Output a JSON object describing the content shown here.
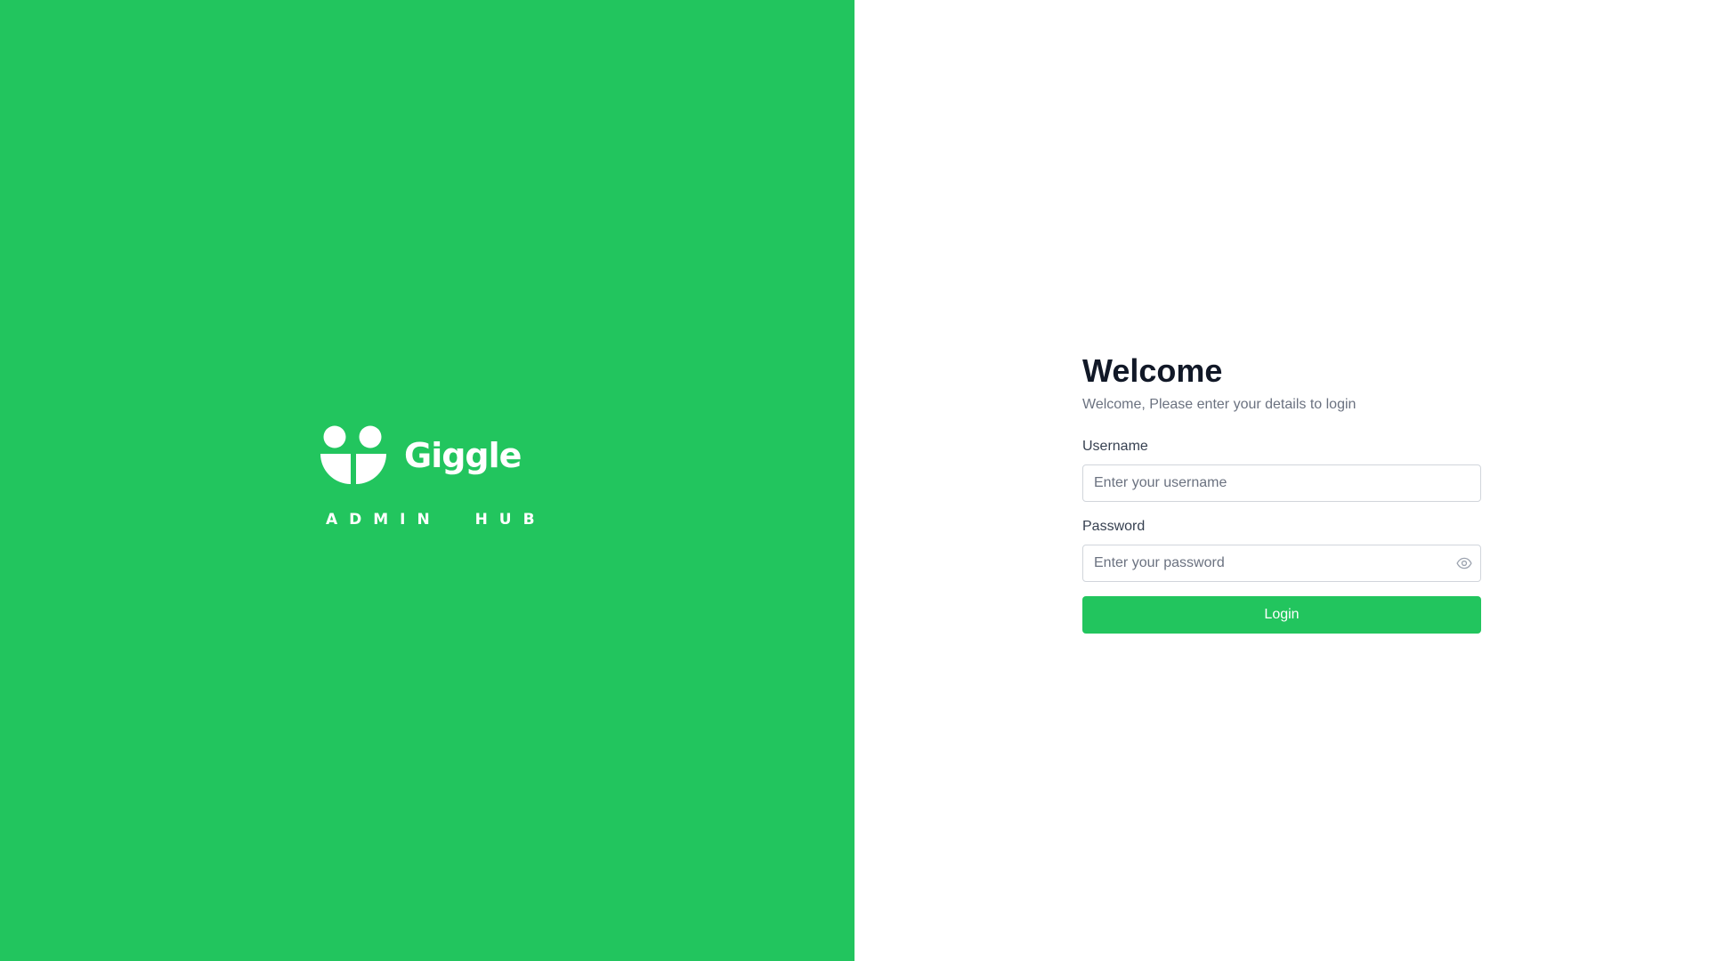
{
  "brand": {
    "name": "Giggle",
    "tagline": "ADMIN  HUB",
    "logo_icon": "giggle-logo-icon",
    "background_color": "#22c55e"
  },
  "login": {
    "title": "Welcome",
    "subtitle": "Welcome, Please enter your details to login",
    "username": {
      "label": "Username",
      "placeholder": "Enter your username",
      "value": ""
    },
    "password": {
      "label": "Password",
      "placeholder": "Enter your password",
      "value": "",
      "toggle_icon": "eye-icon"
    },
    "submit_label": "Login",
    "accent_color": "#22c55e"
  }
}
